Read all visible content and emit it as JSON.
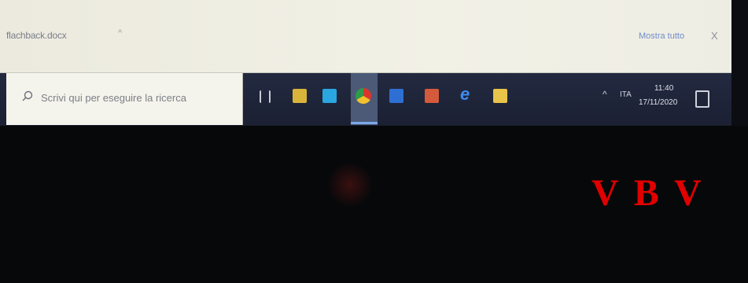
{
  "download_bar": {
    "file_name": "flachback.docx",
    "caret": "^",
    "show_all_label": "Mostra tutto",
    "close_label": "X"
  },
  "taskbar": {
    "search_placeholder": "Scrivi qui per eseguire la ricerca",
    "apps": [
      {
        "name": "task-view-icon"
      },
      {
        "name": "store-icon"
      },
      {
        "name": "mail-icon"
      },
      {
        "name": "chrome-icon",
        "active": true
      },
      {
        "name": "word-icon"
      },
      {
        "name": "powerpoint-icon"
      },
      {
        "name": "edge-icon",
        "glyph": "e"
      },
      {
        "name": "file-explorer-icon"
      }
    ],
    "tray": {
      "up_arrow": "^",
      "language": "ITA",
      "time": "11:40",
      "date": "17/11/2020"
    }
  },
  "watermark": {
    "text": "V B V",
    "color": "#e00000"
  }
}
